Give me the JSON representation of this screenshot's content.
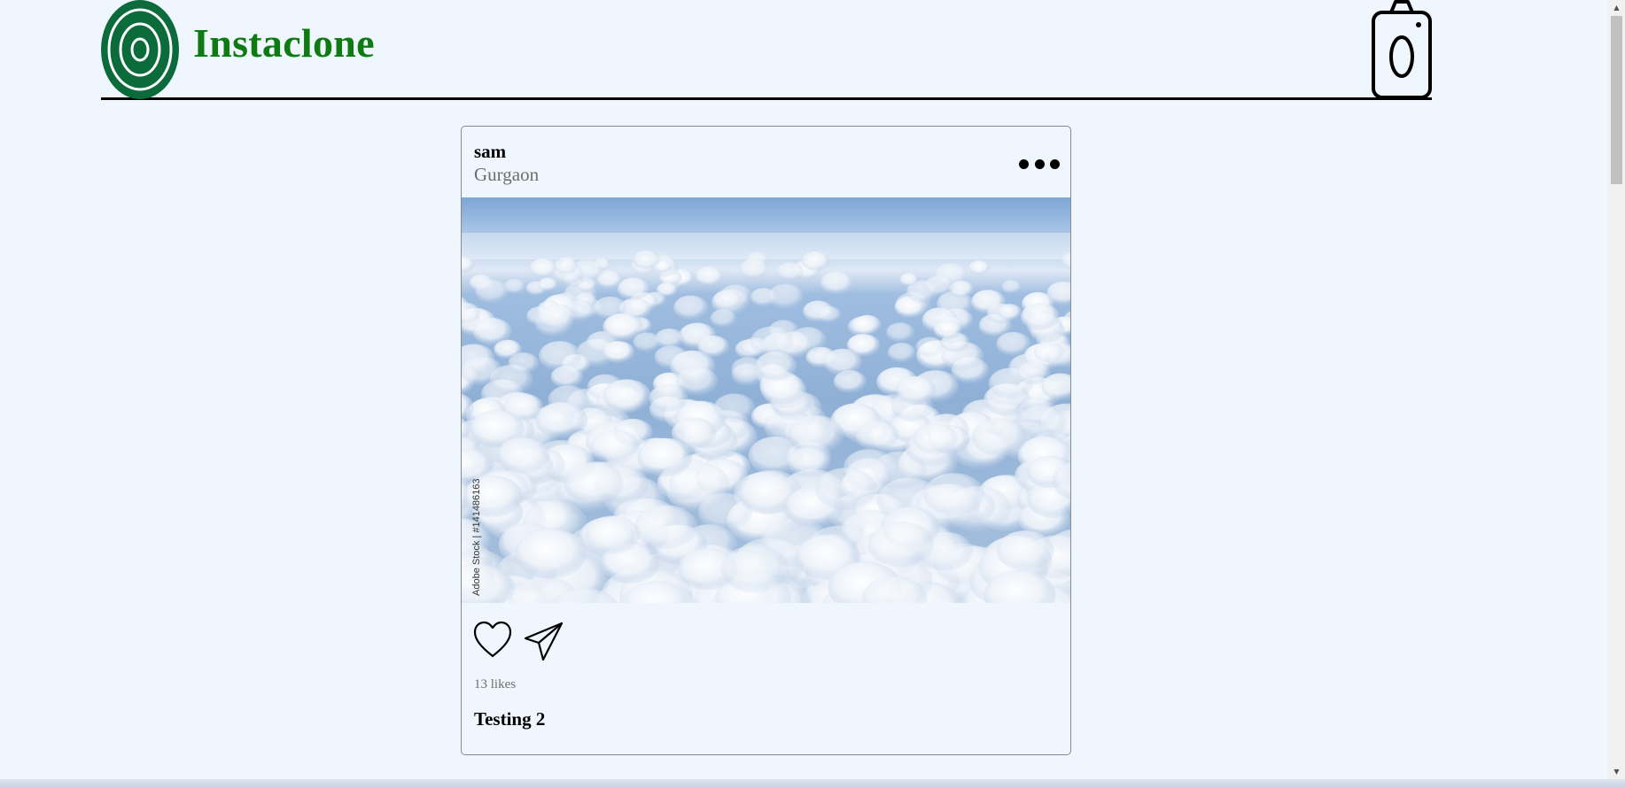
{
  "header": {
    "brand": "Instaclone",
    "logo_icon": "target-logo-icon",
    "camera_icon": "camera-icon",
    "brand_color": "#0e7a12",
    "logo_color": "#0b6b3a"
  },
  "post": {
    "user": "sam",
    "location": "Gurgaon",
    "more_icon": "more-horizontal-icon",
    "image_watermark": "Adobe Stock | #141486163",
    "like_icon": "heart-icon",
    "share_icon": "send-icon",
    "likes": "13 likes",
    "caption": "Testing 2"
  },
  "colors": {
    "background": "#eff6fe",
    "text_muted": "#6e6e6e"
  }
}
